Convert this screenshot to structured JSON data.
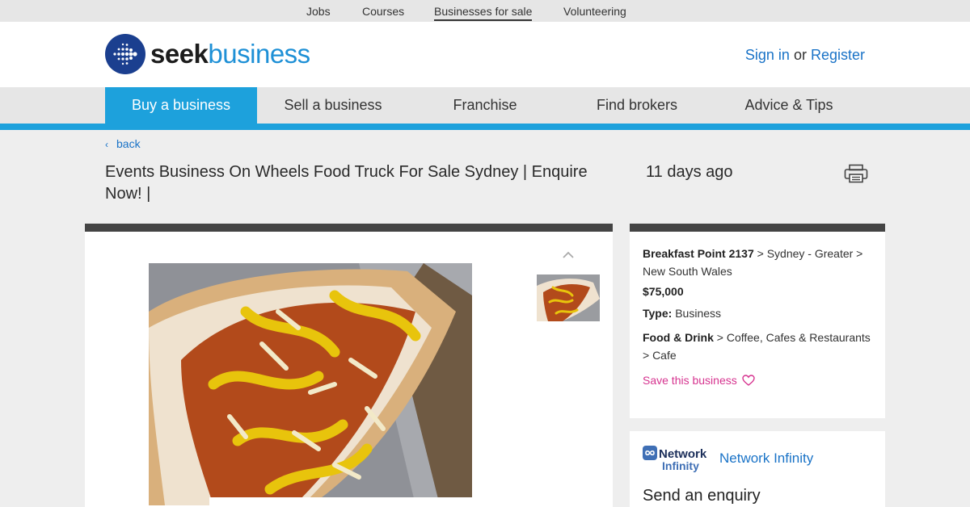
{
  "top_links": [
    {
      "label": "Jobs",
      "active": false
    },
    {
      "label": "Courses",
      "active": false
    },
    {
      "label": "Businesses for sale",
      "active": true
    },
    {
      "label": "Volunteering",
      "active": false
    }
  ],
  "header": {
    "logo_seek": "seek",
    "logo_business": "business",
    "sign_in": "Sign in",
    "or": "or",
    "register": "Register"
  },
  "nav": [
    {
      "label": "Buy a business",
      "active": true
    },
    {
      "label": "Sell a business",
      "active": false
    },
    {
      "label": "Franchise",
      "active": false
    },
    {
      "label": "Find brokers",
      "active": false
    },
    {
      "label": "Advice & Tips",
      "active": false
    }
  ],
  "listing": {
    "back": "back",
    "title": "Events Business On Wheels Food Truck For Sale Sydney | Enquire Now! |",
    "posted": "11 days ago",
    "location_suburb": "Breakfast Point 2137",
    "location_rest": "> Sydney - Greater > New South Wales",
    "price": "$75,000",
    "type_label": "Type:",
    "type_value": "Business",
    "category_main": "Food & Drink",
    "category_rest": "> Coffee, Cafes & Restaurants > Cafe",
    "save_label": "Save this business"
  },
  "agent": {
    "logo_line1": "Network",
    "logo_line2": "Infinity",
    "name": "Network Infinity",
    "enquiry_heading": "Send an enquiry"
  },
  "colors": {
    "brand_blue": "#1da1dc",
    "link_blue": "#1a73c7",
    "save_pink": "#d6338f",
    "card_top_border": "#444444"
  }
}
